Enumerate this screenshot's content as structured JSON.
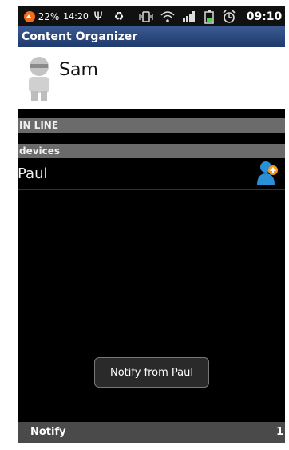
{
  "status_bar": {
    "battery_percent": "22%",
    "clock_small": "14:20",
    "time": "09:10",
    "icons": [
      "notification-badge-icon",
      "usb-icon",
      "recycle-icon",
      "vibrate-icon",
      "wifi-icon",
      "signal-icon",
      "battery-icon",
      "alarm-icon"
    ]
  },
  "app": {
    "title": "Content Organizer"
  },
  "profile": {
    "name": "Sam"
  },
  "sections": {
    "online": "IN LINE",
    "devices": "devices"
  },
  "contacts": [
    {
      "name": "Paul"
    }
  ],
  "toast": {
    "text": "Notify from Paul"
  },
  "notify_bar": {
    "label": "Notify",
    "count": "1"
  },
  "colors": {
    "title_bar": "#1f3a6b",
    "section_bg": "#6b6b6b",
    "add_icon": "#2a8fd8",
    "add_badge": "#f39a1f"
  }
}
